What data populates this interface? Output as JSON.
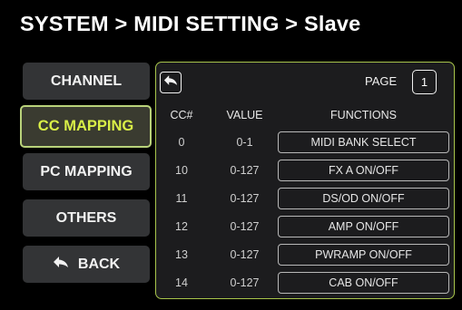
{
  "title": "SYSTEM  >  MIDI SETTING > Slave",
  "nav": {
    "channel": "CHANNEL",
    "cc_mapping": "CC MAPPING",
    "pc_mapping": "PC MAPPING",
    "others": "OTHERS",
    "back": "BACK"
  },
  "panel": {
    "page_label": "PAGE",
    "page_value": "1",
    "headers": {
      "cc": "CC#",
      "value": "VALUE",
      "functions": "FUNCTIONS"
    },
    "rows": [
      {
        "cc": "0",
        "value": "0-1",
        "function": "MIDI BANK SELECT"
      },
      {
        "cc": "10",
        "value": "0-127",
        "function": "FX A ON/OFF"
      },
      {
        "cc": "11",
        "value": "0-127",
        "function": "DS/OD ON/OFF"
      },
      {
        "cc": "12",
        "value": "0-127",
        "function": "AMP ON/OFF"
      },
      {
        "cc": "13",
        "value": "0-127",
        "function": "PWRAMP ON/OFF"
      },
      {
        "cc": "14",
        "value": "0-127",
        "function": "CAB ON/OFF"
      }
    ]
  },
  "colors": {
    "accent": "#d9ef47",
    "panel_border": "#a7c44b",
    "button_bg": "#333436"
  },
  "icons": {
    "back": "back-arrow-icon"
  }
}
